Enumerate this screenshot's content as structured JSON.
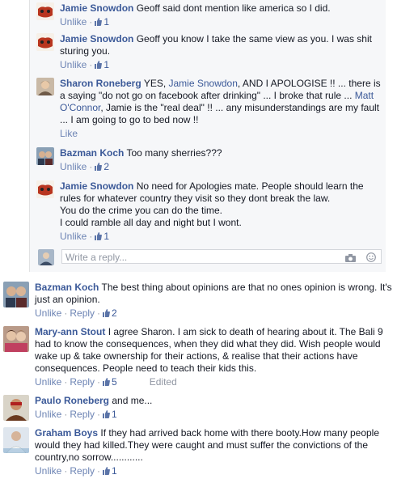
{
  "replies": [
    {
      "author": "Jamie Snowdon",
      "text": "Geoff said dont mention like america so I did.",
      "actions": {
        "unlike": "Unlike",
        "likes": "1"
      }
    },
    {
      "author": "Jamie Snowdon",
      "text": "Geoff you know I take the same view as you. I was shit sturing you.",
      "actions": {
        "unlike": "Unlike",
        "likes": "1"
      }
    },
    {
      "author": "Sharon Roneberg",
      "text_a": "YES, ",
      "mention1": "Jamie Snowdon",
      "text_b": ", AND I APOLOGISE !! ... there is a saying \"do not go on facebook after drinking\" ... I broke that rule ... ",
      "mention2": "Matt O'Connor",
      "text_c": ", Jamie is the \"real deal\" !! ... any misunderstandings are my fault ... I am going to go to bed now !!",
      "actions": {
        "like": "Like"
      }
    },
    {
      "author": "Bazman Koch",
      "text": "Too many sherries???",
      "actions": {
        "unlike": "Unlike",
        "likes": "2"
      }
    },
    {
      "author": "Jamie Snowdon",
      "text1": "No need for Apologies mate. People should learn the rules for whatever country they visit so they dont break the law.",
      "text2": "You do the crime you can do the time.",
      "text3": "I could ramble all day and night but I wont.",
      "actions": {
        "unlike": "Unlike",
        "likes": "1"
      }
    }
  ],
  "reply_box": {
    "placeholder": "Write a reply...",
    "camera_icon": "camera-icon",
    "emoji_icon": "smiley-icon"
  },
  "comments": [
    {
      "author": "Bazman Koch",
      "text": "The best thing about opinions are that no ones opinion is wrong. It's just an opinion.",
      "actions": {
        "unlike": "Unlike",
        "reply": "Reply",
        "likes": "2"
      }
    },
    {
      "author": "Mary-ann Stout",
      "text": "I agree Sharon. I am sick to death of hearing about it. The Bali 9 had to know the consequences, when they did what they did. Wish people would wake up & take ownership for their actions, & realise that their actions have consequences. People need to teach their kids this.",
      "actions": {
        "unlike": "Unlike",
        "reply": "Reply",
        "likes": "5",
        "edited": "Edited"
      }
    },
    {
      "author": "Paulo Roneberg",
      "text": "and me...",
      "actions": {
        "unlike": "Unlike",
        "reply": "Reply",
        "likes": "1"
      }
    },
    {
      "author": "Graham Boys",
      "text": "If they had arrived back home with there booty.How many people would they had killed.They were caught and must suffer the convictions of the country,no sorrow............",
      "actions": {
        "unlike": "Unlike",
        "reply": "Reply",
        "likes": "1"
      }
    }
  ],
  "colors": {
    "link": "#3b5998",
    "action": "#6d84b4",
    "reply_bg": "#f6f7f9"
  }
}
